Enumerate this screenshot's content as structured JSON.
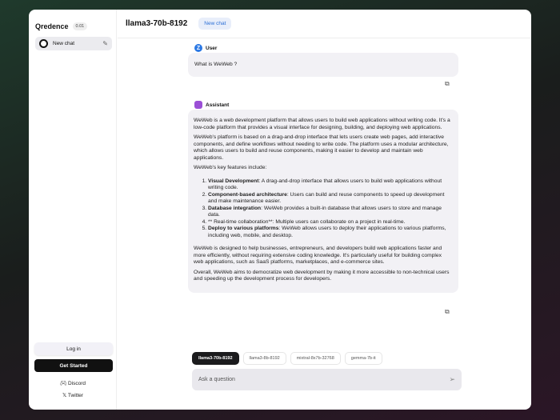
{
  "sidebar": {
    "brand": "Qredence",
    "version": "0.01",
    "chat_item": "New chat",
    "login": "Log in",
    "get_started": "Get Started",
    "discord": "Discord",
    "twitter": "Twitter"
  },
  "header": {
    "model": "llama3-70b-8192",
    "new_chat": "New chat"
  },
  "messages": {
    "user_role": "User",
    "user_avatar": "Z",
    "user_text": "What is WeWeb ?",
    "assistant_role": "Assistant",
    "p1": "WeWeb is a web development platform that allows users to build web applications without writing code. It's a low-code platform that provides a visual interface for designing, building, and deploying web applications.",
    "p2": "WeWeb's platform is based on a drag-and-drop interface that lets users create web pages, add interactive components, and define workflows without needing to write code. The platform uses a modular architecture, which allows users to build and reuse components, making it easier to develop and maintain web applications.",
    "p3": "WeWeb's key features include:",
    "features": [
      {
        "title": "Visual Development",
        "text": ": A drag-and-drop interface that allows users to build web applications without writing code."
      },
      {
        "title": "Component-based architecture",
        "text": ": Users can build and reuse components to speed up development and make maintenance easier."
      },
      {
        "title": "Database integration",
        "text": ": WeWeb provides a built-in database that allows users to store and manage data."
      },
      {
        "title": "",
        "text": "** Real-time collaboration**: Multiple users can collaborate on a project in real-time."
      },
      {
        "title": "Deploy to various platforms",
        "text": ": WeWeb allows users to deploy their applications to various platforms, including web, mobile, and desktop."
      }
    ],
    "p4": "WeWeb is designed to help businesses, entrepreneurs, and developers build web applications faster and more efficiently, without requiring extensive coding knowledge. It's particularly useful for building complex web applications, such as SaaS platforms, marketplaces, and e-commerce sites.",
    "p5": "Overall, WeWeb aims to democratize web development by making it more accessible to non-technical users and speeding up the development process for developers."
  },
  "composer": {
    "models": [
      "llama3-70b-8192",
      "llama3-8b-8192",
      "mixtral-8x7b-32768",
      "gemma-7b-it"
    ],
    "placeholder": "Ask a question"
  }
}
